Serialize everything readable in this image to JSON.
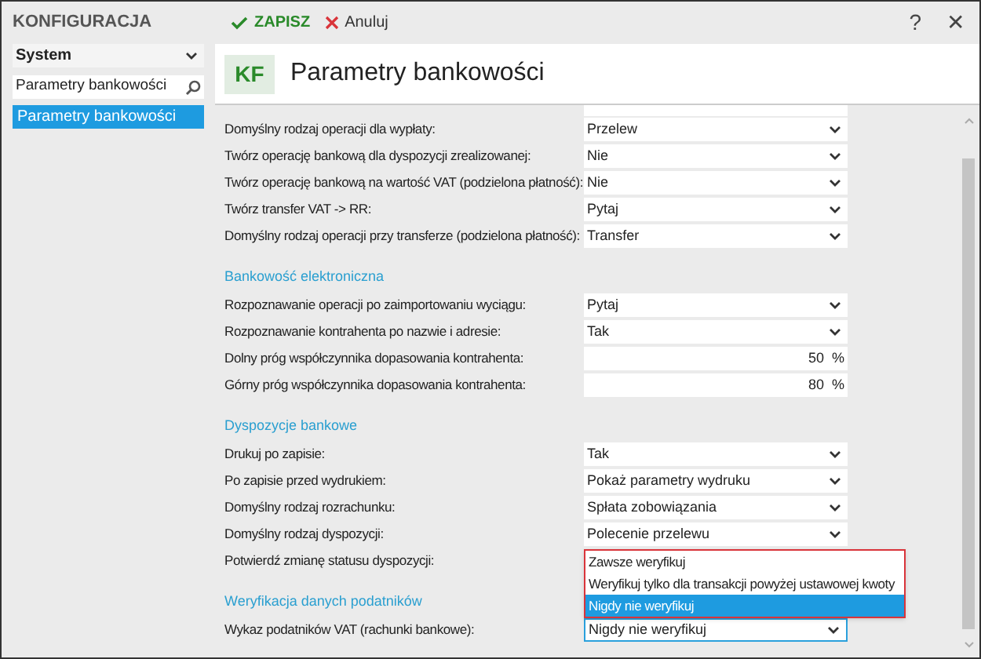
{
  "app_title": "KONFIGURACJA",
  "toolbar": {
    "save": "ZAPISZ",
    "cancel": "Anuluj",
    "help": "?",
    "close": "✕"
  },
  "sidebar": {
    "module": "System",
    "search": {
      "value": "Parametry bankowości"
    },
    "items": [
      {
        "label": "Parametry bankowości",
        "selected": true
      }
    ]
  },
  "header": {
    "badge": "KF",
    "title": "Parametry bankowości"
  },
  "sections": [
    {
      "rows": [
        {
          "kind": "partial"
        },
        {
          "kind": "select",
          "label": "Domyślny rodzaj operacji dla wypłaty:",
          "value": "Przelew"
        },
        {
          "kind": "select",
          "label": "Twórz operację bankową dla dyspozycji zrealizowanej:",
          "value": "Nie"
        },
        {
          "kind": "select",
          "label": "Twórz operację bankową na wartość VAT (podzielona płatność):",
          "value": "Nie"
        },
        {
          "kind": "select",
          "label": "Twórz transfer VAT -> RR:",
          "value": "Pytaj"
        },
        {
          "kind": "select",
          "label": "Domyślny rodzaj operacji przy transferze (podzielona płatność):",
          "value": "Transfer"
        }
      ]
    },
    {
      "title": "Bankowość elektroniczna",
      "rows": [
        {
          "kind": "select",
          "label": "Rozpoznawanie operacji po zaimportowaniu wyciągu:",
          "value": "Pytaj"
        },
        {
          "kind": "select",
          "label": "Rozpoznawanie kontrahenta po nazwie i adresie:",
          "value": "Tak"
        },
        {
          "kind": "number",
          "label": "Dolny próg współczynnika dopasowania kontrahenta:",
          "value": "50",
          "unit": "%"
        },
        {
          "kind": "number",
          "label": "Górny próg współczynnika dopasowania kontrahenta:",
          "value": "80",
          "unit": "%"
        }
      ]
    },
    {
      "title": "Dyspozycje bankowe",
      "rows": [
        {
          "kind": "select",
          "label": "Drukuj po zapisie:",
          "value": "Tak"
        },
        {
          "kind": "select",
          "label": "Po zapisie przed wydrukiem:",
          "value": "Pokaż parametry wydruku"
        },
        {
          "kind": "select",
          "label": "Domyślny rodzaj rozrachunku:",
          "value": "Spłata zobowiązania"
        },
        {
          "kind": "select",
          "label": "Domyślny rodzaj dyspozycji:",
          "value": "Polecenie przelewu"
        },
        {
          "kind": "label",
          "label": "Potwierdź zmianę statusu dyspozycji:"
        }
      ]
    },
    {
      "title": "Weryfikacja danych podatników",
      "rows": [
        {
          "kind": "select",
          "label": "Wykaz podatników VAT (rachunki bankowe):",
          "value": "Nigdy nie weryfikuj",
          "focused": true,
          "dropdown": [
            {
              "label": "Zawsze weryfikuj",
              "selected": false
            },
            {
              "label": "Weryfikuj tylko dla transakcji powyżej ustawowej kwoty",
              "selected": false
            },
            {
              "label": "Nigdy nie weryfikuj",
              "selected": true
            }
          ]
        }
      ]
    }
  ]
}
